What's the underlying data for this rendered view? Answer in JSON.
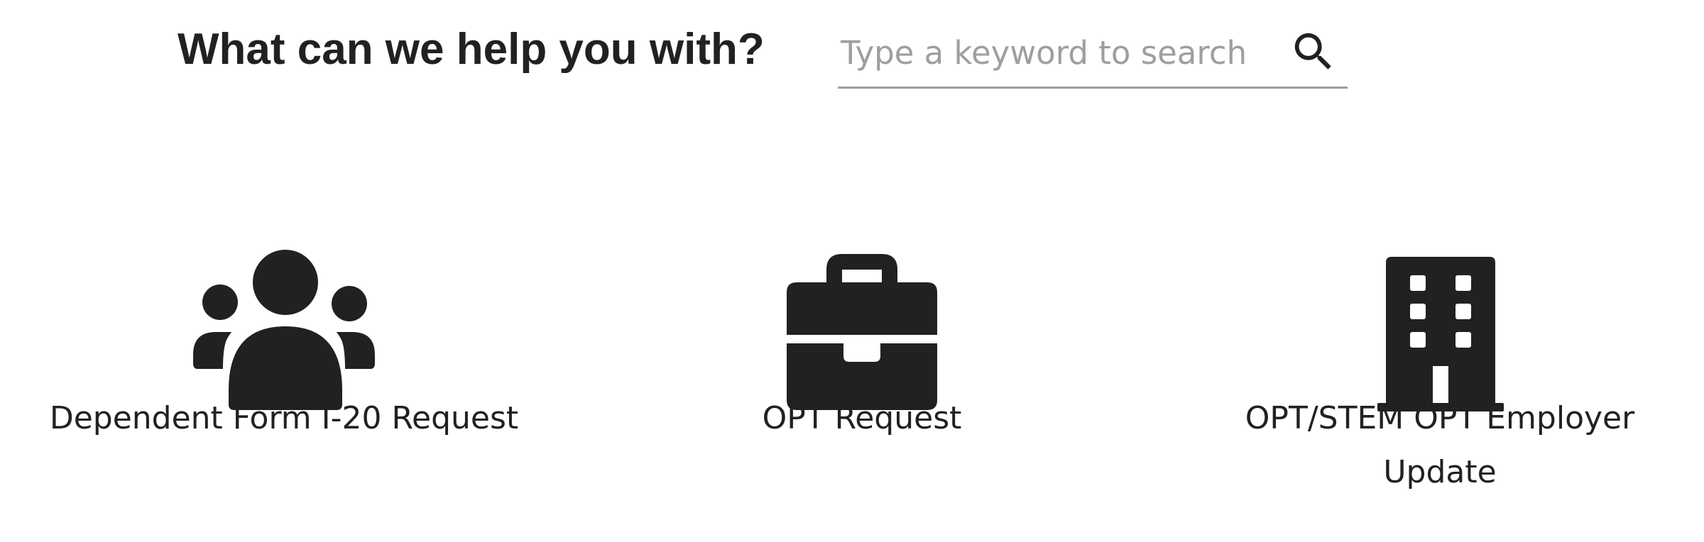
{
  "search": {
    "heading": "What can we help you with?",
    "placeholder": "Type a keyword to search",
    "value": ""
  },
  "services": [
    {
      "label": "Dependent Form I-20 Request",
      "icon": "users-icon"
    },
    {
      "label": "OPT Request",
      "icon": "briefcase-icon"
    },
    {
      "label": "OPT/STEM OPT Employer Update",
      "icon": "building-icon"
    }
  ],
  "colors": {
    "text": "#212121",
    "placeholder": "#9e9e9e",
    "underline": "#9e9e9e",
    "icon": "#212121",
    "background": "#ffffff"
  }
}
